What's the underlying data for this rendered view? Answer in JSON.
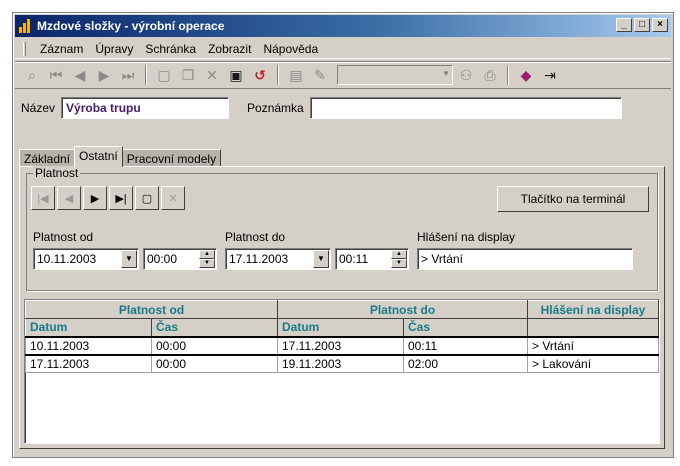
{
  "window": {
    "title": "Mzdové složky - výrobní operace"
  },
  "menu": [
    "Záznam",
    "Úpravy",
    "Schránka",
    "Zobrazit",
    "Nápověda"
  ],
  "form": {
    "name_label": "Název",
    "name_value": "Výroba trupu",
    "note_label": "Poznámka",
    "note_value": ""
  },
  "tabs": [
    "Základní",
    "Ostatní",
    "Pracovní modely"
  ],
  "active_tab": "Ostatní",
  "validity": {
    "group_title": "Platnost",
    "terminal_button": "Tlačítko na terminál",
    "from_label": "Platnost od",
    "to_label": "Platnost do",
    "display_label": "Hlášení na display",
    "from_date": "10.11.2003",
    "from_time": "00:00",
    "to_date": "17.11.2003",
    "to_time": "00:11",
    "display_value": "> Vrtání"
  },
  "grid": {
    "group_headers": [
      "Platnost od",
      "Platnost do",
      "Hlášení na display"
    ],
    "sub_headers": [
      "Datum",
      "Čas",
      "Datum",
      "Čas",
      ""
    ],
    "rows": [
      [
        "10.11.2003",
        "00:00",
        "17.11.2003",
        "00:11",
        "> Vrtání"
      ],
      [
        "17.11.2003",
        "00:00",
        "19.11.2003",
        "02:00",
        "> Lakování"
      ]
    ]
  },
  "icons": {
    "toolbar": [
      "search-icon",
      "first-record-icon",
      "prev-record-icon",
      "next-record-icon",
      "last-record-icon",
      "new-record-icon",
      "copy-record-icon",
      "delete-record-icon",
      "save-icon",
      "cancel-changes-icon",
      "form-view-icon",
      "filter-icon",
      "binoculars-icon",
      "print-icon",
      "help-book-icon",
      "exit-icon"
    ]
  },
  "colors": {
    "title_gradient_start": "#0a246a",
    "header_text": "#1a7a8a",
    "name_value_text": "#4b1a6e"
  }
}
